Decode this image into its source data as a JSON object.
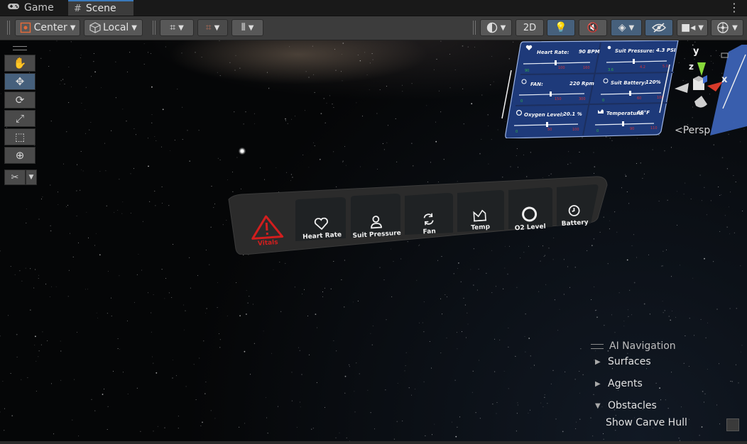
{
  "tabs": [
    {
      "label": "Game",
      "icon": "gamepad-icon",
      "active": false
    },
    {
      "label": "Scene",
      "icon": "hash-icon",
      "active": true
    }
  ],
  "toolbar": {
    "pivot_label": "Center",
    "rotation_label": "Local",
    "mode_2d_label": "2D",
    "accent_color": "#46607c"
  },
  "vitals_bar": {
    "alert": {
      "label": "Vitals",
      "icon": "warning-icon",
      "color": "#d21e1e"
    },
    "items": [
      {
        "label": "Heart Rate",
        "icon": "heart-icon"
      },
      {
        "label": "Suit Pressure",
        "icon": "pressure-gauge-icon"
      },
      {
        "label": "Fan",
        "icon": "fan-cycle-icon"
      },
      {
        "label": "Temp",
        "icon": "temperature-icon"
      },
      {
        "label": "O2 Level",
        "icon": "o2-ring-icon"
      },
      {
        "label": "Battery",
        "icon": "battery-clock-icon"
      }
    ]
  },
  "monitor_panel": {
    "heart_rate": {
      "label": "Heart Rate:",
      "value": "90 BPM"
    },
    "suit_pressure": {
      "label": "Suit Pressure:",
      "value": "4.3 PSI"
    },
    "fan": {
      "label": "FAN:",
      "value": "220 Rpm"
    },
    "suit_battery": {
      "label": "Suit Battery:",
      "value": "120%"
    },
    "oxygen": {
      "label": "Oxygen Level:",
      "value": "20.1 %"
    },
    "temperature": {
      "label": "Temperature:",
      "value": "65°F"
    }
  },
  "gizmo": {
    "x": "x",
    "y": "y",
    "z": "z",
    "projection": "Persp"
  },
  "overlay": {
    "title": "AI Navigation",
    "surfaces": "Surfaces",
    "agents": "Agents",
    "obstacles": "Obstacles",
    "show_carve_hull": "Show Carve Hull"
  }
}
